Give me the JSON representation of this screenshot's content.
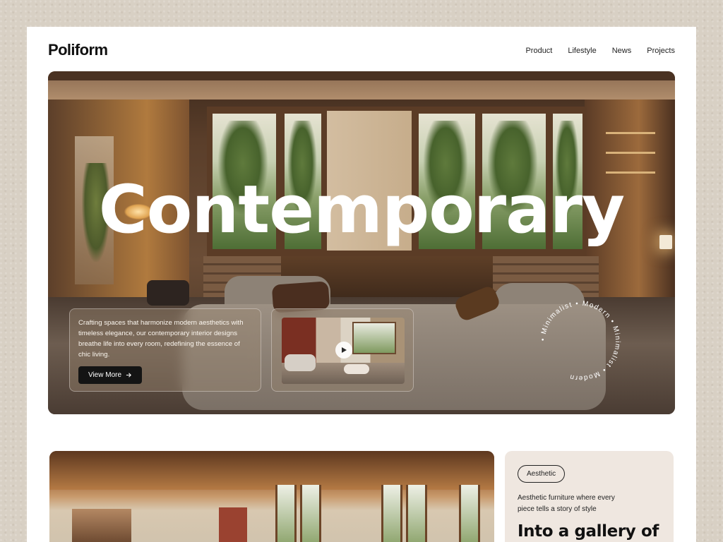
{
  "brand": {
    "name": "Poliform"
  },
  "nav": {
    "items": [
      {
        "label": "Product"
      },
      {
        "label": "Lifestyle"
      },
      {
        "label": "News"
      },
      {
        "label": "Projects"
      }
    ]
  },
  "hero": {
    "title": "Contemporary",
    "description": "Crafting spaces that harmonize modern aesthetics with timeless elegance, our contemporary interior designs breathe life into every room, redefining the essence of chic living.",
    "cta_label": "View More",
    "cta_icon": "arrow-right-icon",
    "video_icon": "play-icon",
    "badge_text": "• Minimalist • Modern • Minimalist • Modern "
  },
  "section2": {
    "tag": "Aesthetic",
    "text": "Aesthetic furniture where every piece tells a story of style",
    "heading": "Into a gallery of elegance"
  },
  "colors": {
    "accent_dark": "#141414",
    "card_bg": "#efe7e0",
    "page_bg": "#d8d0c4"
  }
}
